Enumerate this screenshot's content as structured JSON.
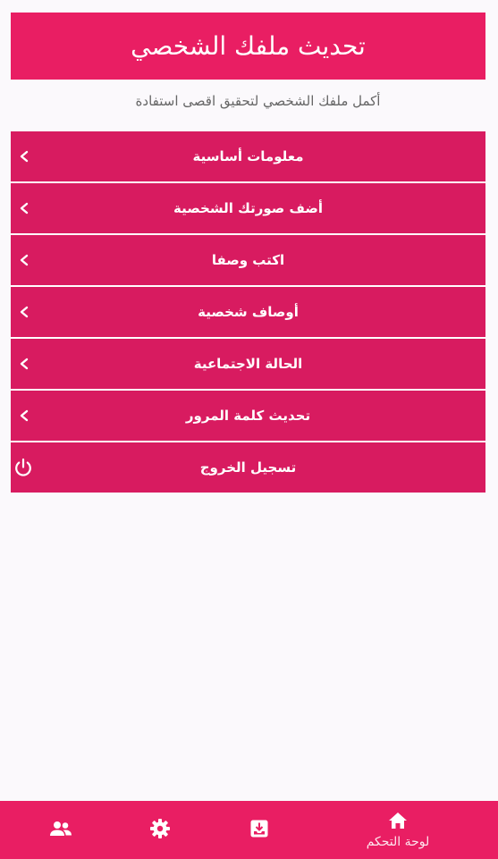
{
  "header": {
    "title": "تحديث ملفك الشخصي",
    "subtitle": "أكمل ملفك الشخصي لتحقيق اقصى استفادة"
  },
  "menu": {
    "items": [
      {
        "label": "معلومات أساسية",
        "icon": "chevron-left-icon"
      },
      {
        "label": "أضف صورتك الشخصية",
        "icon": "chevron-left-icon"
      },
      {
        "label": "اكتب وصفا",
        "icon": "chevron-left-icon"
      },
      {
        "label": "أوصاف شخصية",
        "icon": "chevron-left-icon"
      },
      {
        "label": "الحالة الاجتماعية",
        "icon": "chevron-left-icon"
      },
      {
        "label": "تحديث كلمة المرور",
        "icon": "chevron-left-icon"
      },
      {
        "label": "تسجيل الخروج",
        "icon": "power-icon"
      }
    ]
  },
  "bottom_nav": {
    "items": [
      {
        "icon": "people-icon"
      },
      {
        "icon": "gear-icon"
      },
      {
        "icon": "inbox-download-icon"
      },
      {
        "icon": "home-icon",
        "label": "لوحة التحكم",
        "active": true
      }
    ]
  },
  "colors": {
    "accent": "#e91e63",
    "menu_bg": "#d81b60",
    "background": "#fbf9fc"
  }
}
